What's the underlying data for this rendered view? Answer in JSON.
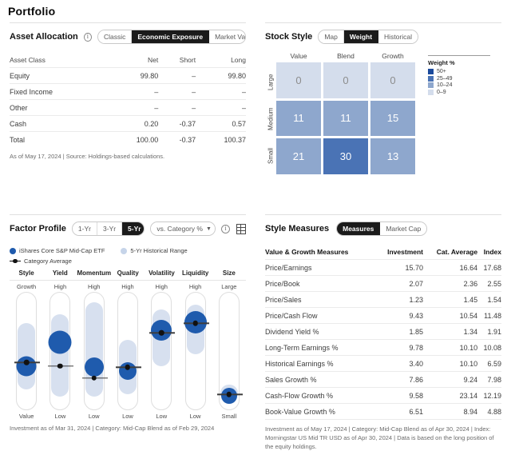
{
  "page": {
    "title": "Portfolio"
  },
  "asset_allocation": {
    "title": "Asset Allocation",
    "info_icon": "info-icon",
    "toggles": [
      {
        "label": "Classic",
        "active": false
      },
      {
        "label": "Economic Exposure",
        "active": true
      },
      {
        "label": "Market Value",
        "active": false
      }
    ],
    "columns": [
      "Asset Class",
      "Net",
      "Short",
      "Long"
    ],
    "rows": [
      {
        "cells": [
          "Equity",
          "99.80",
          "–",
          "99.80"
        ],
        "total": false
      },
      {
        "cells": [
          "Fixed Income",
          "–",
          "–",
          "–"
        ],
        "total": false
      },
      {
        "cells": [
          "Other",
          "–",
          "–",
          "–"
        ],
        "total": false
      },
      {
        "cells": [
          "Cash",
          "0.20",
          "-0.37",
          "0.57"
        ],
        "total": false
      },
      {
        "cells": [
          "Total",
          "100.00",
          "-0.37",
          "100.37"
        ],
        "total": true
      }
    ],
    "footnote": "As of May 17, 2024 | Source: Holdings-based calculations."
  },
  "stock_style": {
    "title": "Stock Style",
    "toggles": [
      {
        "label": "Map",
        "active": false
      },
      {
        "label": "Weight",
        "active": true
      },
      {
        "label": "Historical",
        "active": false
      }
    ],
    "col_labels": [
      "Value",
      "Blend",
      "Growth"
    ],
    "row_labels": [
      "Large",
      "Medium",
      "Small"
    ],
    "cells": [
      [
        {
          "value": "0",
          "color": "#d4ddec",
          "band": "0-9"
        },
        {
          "value": "0",
          "color": "#d4ddec",
          "band": "0-9"
        },
        {
          "value": "0",
          "color": "#d4ddec",
          "band": "0-9"
        }
      ],
      [
        {
          "value": "11",
          "color": "#8ea7cd",
          "band": "10-24"
        },
        {
          "value": "11",
          "color": "#8ea7cd",
          "band": "10-24"
        },
        {
          "value": "15",
          "color": "#8ea7cd",
          "band": "10-24"
        }
      ],
      [
        {
          "value": "21",
          "color": "#8ea7cd",
          "band": "10-24"
        },
        {
          "value": "30",
          "color": "#4a73b5",
          "band": "25-49"
        },
        {
          "value": "13",
          "color": "#8ea7cd",
          "band": "10-24"
        }
      ]
    ],
    "legend": {
      "title": "Weight %",
      "items": [
        {
          "label": "50+",
          "color": "#1b4a9c"
        },
        {
          "label": "25–49",
          "color": "#4a73b5"
        },
        {
          "label": "10–24",
          "color": "#8ea7cd"
        },
        {
          "label": "0–9",
          "color": "#d4ddec"
        }
      ]
    }
  },
  "factor_profile": {
    "title": "Factor Profile",
    "toggles": [
      {
        "label": "1-Yr",
        "active": false
      },
      {
        "label": "3-Yr",
        "active": false
      },
      {
        "label": "5-Yr",
        "active": true
      }
    ],
    "dropdown": {
      "label": "vs. Category %",
      "caret": "chevron-down-icon"
    },
    "info_icon": "info-icon",
    "table_icon": "table-view-icon",
    "legend": [
      {
        "label": "iShares Core S&P Mid-Cap ETF",
        "type": "dot",
        "color": "#1f5bad"
      },
      {
        "label": "5-Yr Historical Range",
        "type": "dot",
        "color": "#c6d4e9"
      },
      {
        "label": "Category Average",
        "type": "line-dot",
        "color": "#111111"
      }
    ],
    "columns": [
      {
        "name": "Style",
        "top": "Growth",
        "bottom": "Value",
        "range_top_pct": 26,
        "range_bottom_pct": 82,
        "bubble_pct": 62,
        "bubble_size": 25,
        "cat_avg_pct": 59
      },
      {
        "name": "Yield",
        "top": "High",
        "bottom": "Low",
        "range_top_pct": 18,
        "range_bottom_pct": 88,
        "bubble_pct": 42,
        "bubble_size": 29,
        "cat_avg_pct": 62
      },
      {
        "name": "Momentum",
        "top": "High",
        "bottom": "Low",
        "range_top_pct": 8,
        "range_bottom_pct": 88,
        "bubble_pct": 63,
        "bubble_size": 24,
        "cat_avg_pct": 72
      },
      {
        "name": "Quality",
        "top": "High",
        "bottom": "Low",
        "range_top_pct": 40,
        "range_bottom_pct": 86,
        "bubble_pct": 66,
        "bubble_size": 22,
        "cat_avg_pct": 63
      },
      {
        "name": "Volatility",
        "top": "High",
        "bottom": "Low",
        "range_top_pct": 14,
        "range_bottom_pct": 62,
        "bubble_pct": 32,
        "bubble_size": 26,
        "cat_avg_pct": 34
      },
      {
        "name": "Liquidity",
        "top": "High",
        "bottom": "Low",
        "range_top_pct": 10,
        "range_bottom_pct": 52,
        "bubble_pct": 25,
        "bubble_size": 28,
        "cat_avg_pct": 26
      },
      {
        "name": "Size",
        "top": "Large",
        "bottom": "Small",
        "range_top_pct": 78,
        "range_bottom_pct": 92,
        "bubble_pct": 87,
        "bubble_size": 20,
        "cat_avg_pct": 86
      }
    ],
    "footnote": "Investment as of Mar 31, 2024 | Category: Mid-Cap Blend as of Feb 29, 2024"
  },
  "style_measures": {
    "title": "Style Measures",
    "toggles": [
      {
        "label": "Measures",
        "active": true
      },
      {
        "label": "Market Cap",
        "active": false
      }
    ],
    "columns": [
      "Value & Growth Measures",
      "Investment",
      "Cat. Average",
      "Index"
    ],
    "rows": [
      [
        "Price/Earnings",
        "15.70",
        "16.64",
        "17.68"
      ],
      [
        "Price/Book",
        "2.07",
        "2.36",
        "2.55"
      ],
      [
        "Price/Sales",
        "1.23",
        "1.45",
        "1.54"
      ],
      [
        "Price/Cash Flow",
        "9.43",
        "10.54",
        "11.48"
      ],
      [
        "Dividend Yield %",
        "1.85",
        "1.34",
        "1.91"
      ],
      [
        "Long-Term Earnings %",
        "9.78",
        "10.10",
        "10.08"
      ],
      [
        "Historical Earnings %",
        "3.40",
        "10.10",
        "6.59"
      ],
      [
        "Sales Growth %",
        "7.86",
        "9.24",
        "7.98"
      ],
      [
        "Cash-Flow Growth %",
        "9.58",
        "23.14",
        "12.19"
      ],
      [
        "Book-Value Growth %",
        "6.51",
        "8.94",
        "4.88"
      ]
    ],
    "footnote": "Investment as of May 17, 2024 | Category: Mid-Cap Blend as of Apr 30, 2024 | Index: Morningstar US Mid TR USD as of Apr 30, 2024 | Data is based on the long position of the equity holdings."
  }
}
